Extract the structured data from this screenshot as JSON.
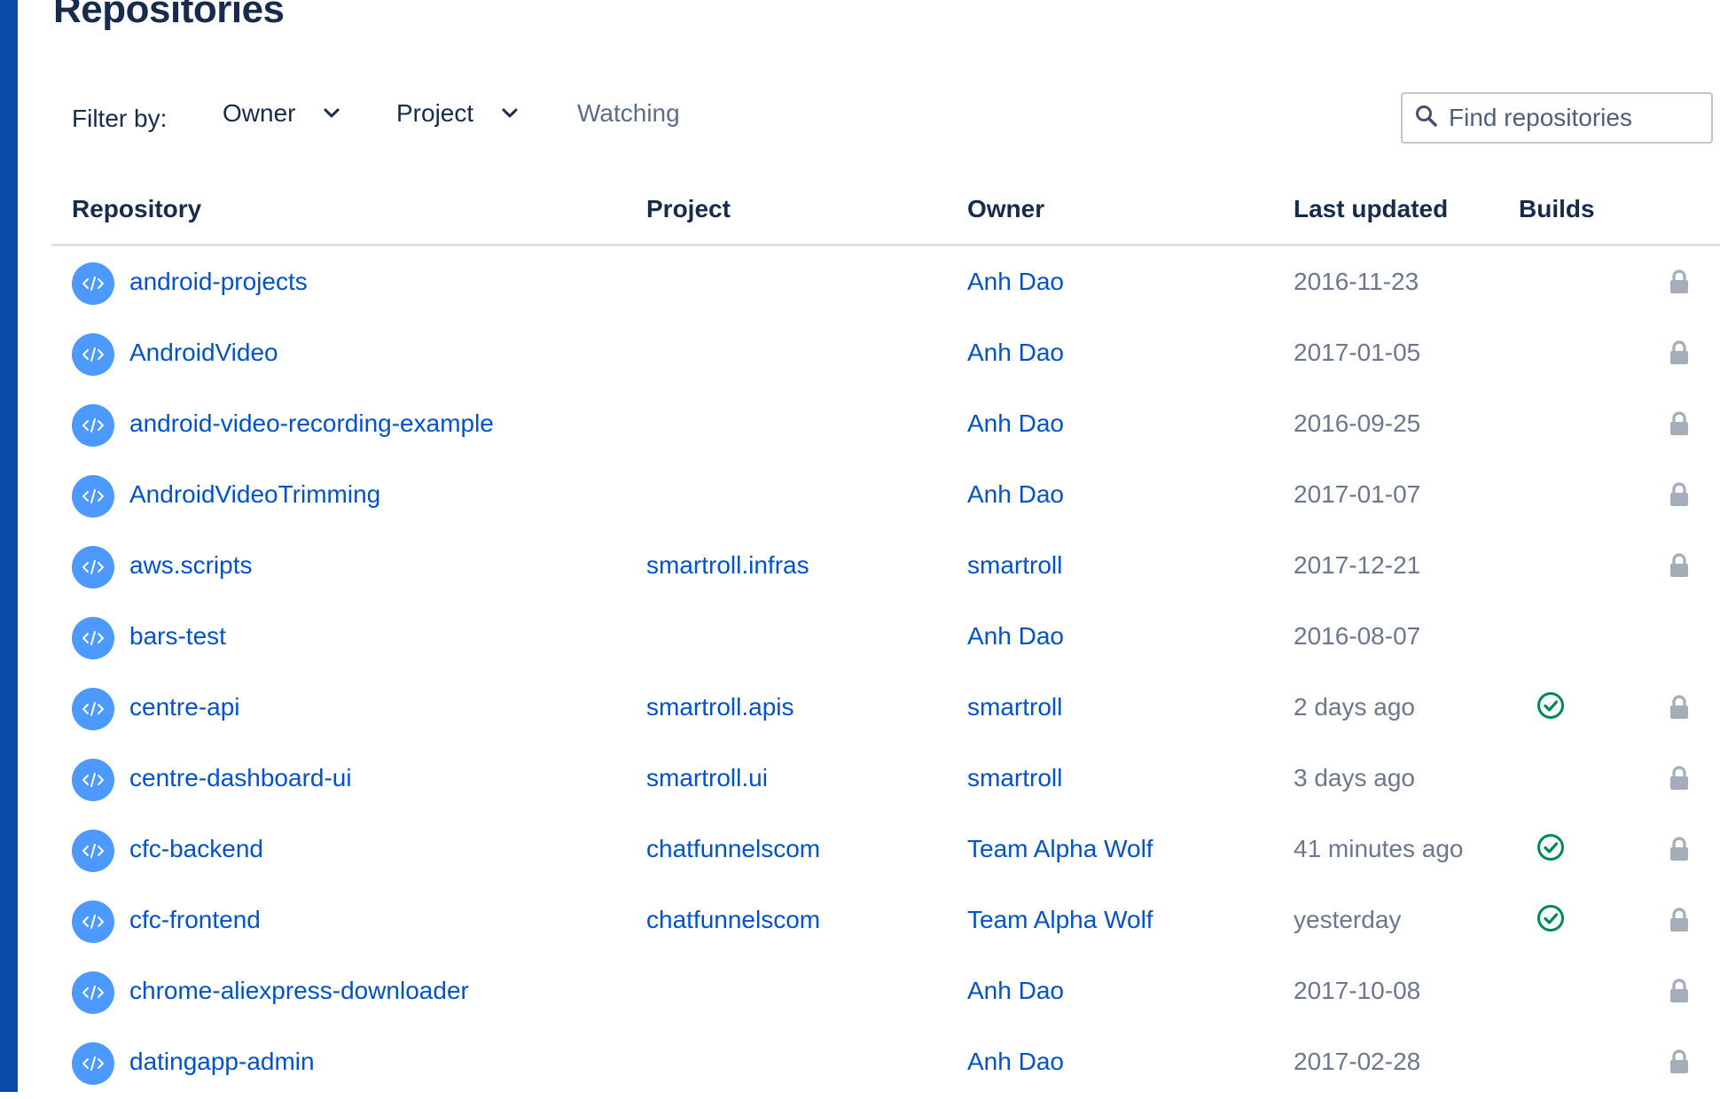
{
  "page": {
    "title": "Repositories"
  },
  "filters": {
    "label": "Filter by:",
    "owner": "Owner",
    "project": "Project",
    "watching": "Watching"
  },
  "search": {
    "placeholder": "Find repositories",
    "value": ""
  },
  "table": {
    "columns": {
      "repository": "Repository",
      "project": "Project",
      "owner": "Owner",
      "last_updated": "Last updated",
      "builds": "Builds"
    },
    "rows": [
      {
        "name": "android-projects",
        "project": "",
        "owner": "Anh Dao",
        "updated": "2016-11-23",
        "build": "",
        "private": true
      },
      {
        "name": "AndroidVideo",
        "project": "",
        "owner": "Anh Dao",
        "updated": "2017-01-05",
        "build": "",
        "private": true
      },
      {
        "name": "android-video-recording-example",
        "project": "",
        "owner": "Anh Dao",
        "updated": "2016-09-25",
        "build": "",
        "private": true
      },
      {
        "name": "AndroidVideoTrimming",
        "project": "",
        "owner": "Anh Dao",
        "updated": "2017-01-07",
        "build": "",
        "private": true
      },
      {
        "name": "aws.scripts",
        "project": "smartroll.infras",
        "owner": "smartroll",
        "updated": "2017-12-21",
        "build": "",
        "private": true
      },
      {
        "name": "bars-test",
        "project": "",
        "owner": "Anh Dao",
        "updated": "2016-08-07",
        "build": "",
        "private": false
      },
      {
        "name": "centre-api",
        "project": "smartroll.apis",
        "owner": "smartroll",
        "updated": "2 days ago",
        "build": "success",
        "private": true
      },
      {
        "name": "centre-dashboard-ui",
        "project": "smartroll.ui",
        "owner": "smartroll",
        "updated": "3 days ago",
        "build": "",
        "private": true
      },
      {
        "name": "cfc-backend",
        "project": "chatfunnelscom",
        "owner": "Team Alpha Wolf",
        "updated": "41 minutes ago",
        "build": "success",
        "private": true
      },
      {
        "name": "cfc-frontend",
        "project": "chatfunnelscom",
        "owner": "Team Alpha Wolf",
        "updated": "yesterday",
        "build": "success",
        "private": true
      },
      {
        "name": "chrome-aliexpress-downloader",
        "project": "",
        "owner": "Anh Dao",
        "updated": "2017-10-08",
        "build": "",
        "private": true
      },
      {
        "name": "datingapp-admin",
        "project": "",
        "owner": "Anh Dao",
        "updated": "2017-02-28",
        "build": "",
        "private": true
      }
    ]
  },
  "icons": {
    "repo": "code-icon",
    "build_success": "check-circle-icon",
    "private": "lock-icon",
    "search": "search-icon",
    "dropdown": "chevron-down-icon"
  },
  "colors": {
    "sidebar": "#0b4aa6",
    "link": "#0052cc",
    "text": "#172b4d",
    "muted": "#6b778c",
    "repo_icon": "#4c9aff",
    "success": "#00875a",
    "lock": "#a5adba"
  }
}
